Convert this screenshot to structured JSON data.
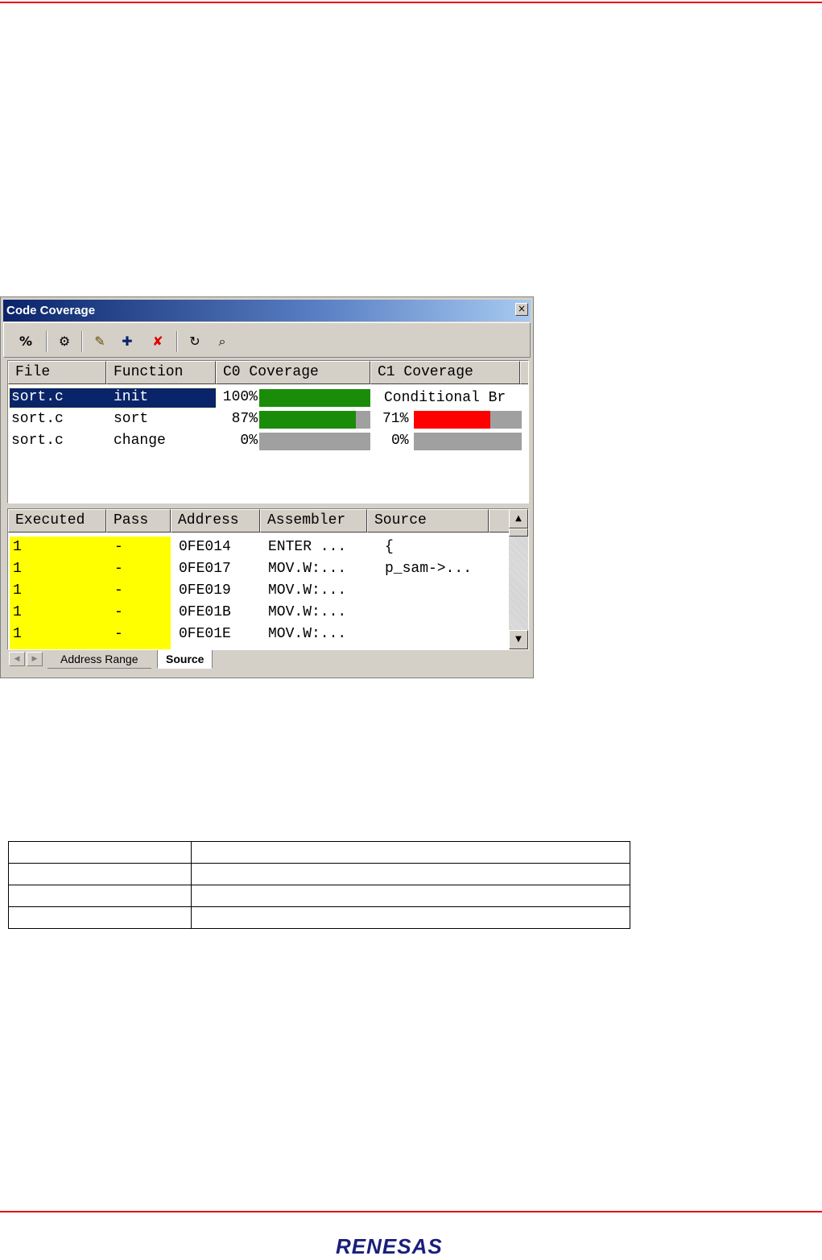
{
  "window": {
    "title": "Code Coverage",
    "close_glyph": "×"
  },
  "toolbar": {
    "buttons": [
      {
        "icon": "percent-icon",
        "glyph": "%"
      },
      {
        "icon": "filter-icon",
        "glyph": "⚙"
      },
      {
        "icon": "edit-range-icon",
        "glyph": "✎"
      },
      {
        "icon": "add-range-icon",
        "glyph": "✚"
      },
      {
        "icon": "delete-range-icon",
        "glyph": "✘"
      },
      {
        "icon": "refresh-icon",
        "glyph": "↻"
      },
      {
        "icon": "find-icon",
        "glyph": "⌕"
      }
    ]
  },
  "upper_table": {
    "headers": [
      "File",
      "Function",
      "C0 Coverage",
      "C1 Coverage"
    ],
    "rows": [
      {
        "file": "sort.c",
        "function": "init",
        "c0_text": "100%",
        "c0_percent": 100,
        "c1_text": "Conditional Br",
        "c1_percent": null,
        "selected": true
      },
      {
        "file": "sort.c",
        "function": "sort",
        "c0_text": "87%",
        "c0_percent": 87,
        "c1_text": "71%",
        "c1_percent": 71,
        "selected": false
      },
      {
        "file": "sort.c",
        "function": "change",
        "c0_text": "0%",
        "c0_percent": 0,
        "c1_text": "0%",
        "c1_percent": 0,
        "selected": false
      }
    ]
  },
  "lower_table": {
    "headers": [
      "Executed",
      "Pass",
      "Address",
      "Assembler",
      "Source"
    ],
    "rows": [
      {
        "executed": "1",
        "pass": "-",
        "address": "0FE014",
        "assembler": "ENTER ...",
        "source": "{"
      },
      {
        "executed": "1",
        "pass": "-",
        "address": "0FE017",
        "assembler": "MOV.W:...",
        "source": "p_sam->..."
      },
      {
        "executed": "1",
        "pass": "-",
        "address": "0FE019",
        "assembler": "MOV.W:...",
        "source": ""
      },
      {
        "executed": "1",
        "pass": "-",
        "address": "0FE01B",
        "assembler": "MOV.W:...",
        "source": ""
      },
      {
        "executed": "1",
        "pass": "-",
        "address": "0FE01E",
        "assembler": "MOV.W:...",
        "source": ""
      }
    ]
  },
  "tabs": {
    "items": [
      "Address Range",
      "Source"
    ],
    "active": "Source"
  },
  "colors": {
    "c0_bar": "#1a8c0a",
    "c1_bar": "#ff0000",
    "executed_highlight": "#ffff00",
    "selection": "#0a246a",
    "brand_rule": "#e60012"
  },
  "footer": {
    "logo": "RENESAS"
  }
}
